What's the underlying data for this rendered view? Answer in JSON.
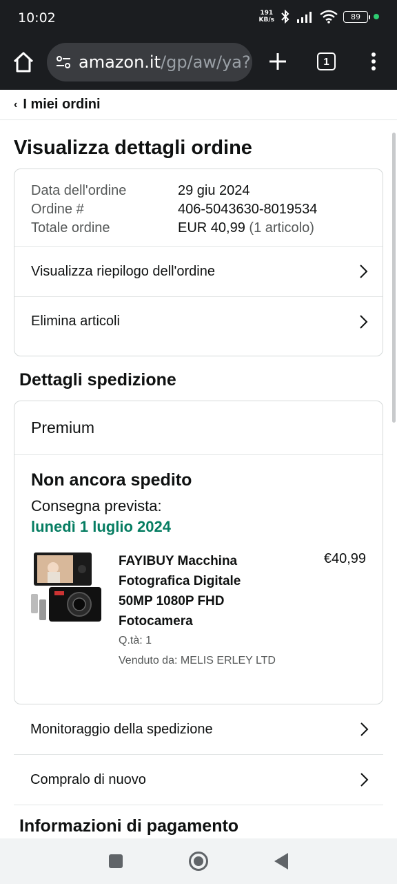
{
  "status_bar": {
    "time": "10:02",
    "net_speed_value": "191",
    "net_speed_unit": "KB/s",
    "battery": "89"
  },
  "browser": {
    "url_domain": "amazon.it",
    "url_path": "/gp/aw/ya?",
    "tab_count": "1"
  },
  "page": {
    "back_label": "I miei ordini",
    "title": "Visualizza dettagli ordine",
    "order_info": [
      {
        "label": "Data dell'ordine",
        "value": "29 giu 2024"
      },
      {
        "label": "Ordine #",
        "value": "406-5043630-8019534"
      },
      {
        "label": "Totale ordine",
        "value": "EUR 40,99",
        "extra": "(1 articolo)"
      }
    ],
    "order_links": [
      "Visualizza riepilogo dell'ordine",
      "Elimina articoli"
    ],
    "shipment_section_title": "Dettagli spedizione",
    "shipment": {
      "method": "Premium",
      "status": "Non ancora spedito",
      "expected_label": "Consegna prevista:",
      "expected_date": "lunedì 1 luglio 2024",
      "item": {
        "title": "FAYIBUY Macchina Fotografica Digitale 50MP 1080P FHD Fotocamera",
        "price": "€40,99",
        "quantity": "Q.tà: 1",
        "seller": "Venduto da: MELIS ERLEY LTD"
      }
    },
    "shipment_links": [
      "Monitoraggio della spedizione",
      "Compralo di nuovo"
    ],
    "payment_section_title": "Informazioni di pagamento"
  },
  "colors": {
    "delivery_green": "#067d62",
    "chrome_bg": "#1b1d20"
  }
}
